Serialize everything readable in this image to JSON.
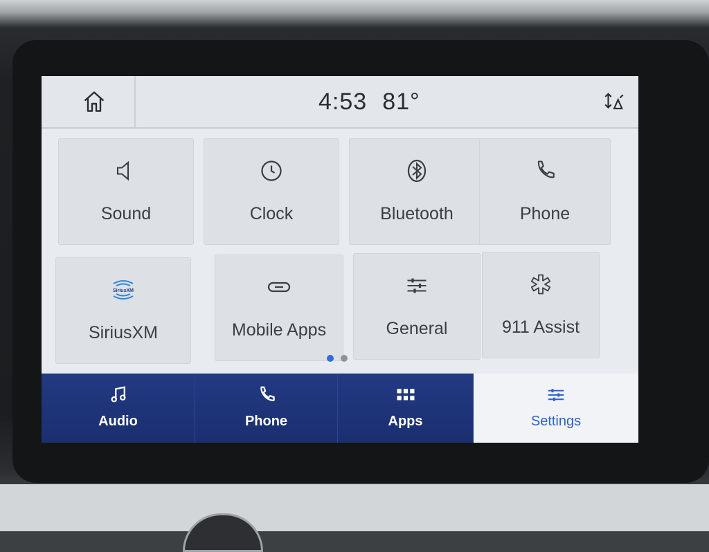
{
  "status_bar": {
    "time": "4:53",
    "temperature": "81°"
  },
  "icons": {
    "home": "home-icon",
    "navigation_arrows": "navigation-arrows-icon"
  },
  "tiles": [
    {
      "label": "Sound",
      "icon": "speaker-icon"
    },
    {
      "label": "Clock",
      "icon": "clock-icon"
    },
    {
      "label": "Bluetooth",
      "icon": "bluetooth-icon"
    },
    {
      "label": "Phone",
      "icon": "phone-icon"
    },
    {
      "label": "SiriusXM",
      "icon": "siriusxm-logo-icon",
      "logo_text": "SiriusXM"
    },
    {
      "label": "Mobile Apps",
      "icon": "link-icon"
    },
    {
      "label": "General",
      "icon": "sliders-icon"
    },
    {
      "label": "911 Assist",
      "icon": "asterisk-icon"
    }
  ],
  "pagination": {
    "current_page": 1,
    "total_pages": 2
  },
  "bottom_nav": {
    "items": [
      {
        "label": "Audio",
        "icon": "music-note-icon"
      },
      {
        "label": "Phone",
        "icon": "phone-icon"
      },
      {
        "label": "Apps",
        "icon": "apps-grid-icon"
      },
      {
        "label": "Settings",
        "icon": "settings-sliders-icon"
      }
    ],
    "active_index": 3
  },
  "colors": {
    "nav_background": "#1f3478",
    "active_accent": "#2d63c8",
    "pagination_active": "#2f6fd6",
    "screen_background": "#e8ebef"
  }
}
